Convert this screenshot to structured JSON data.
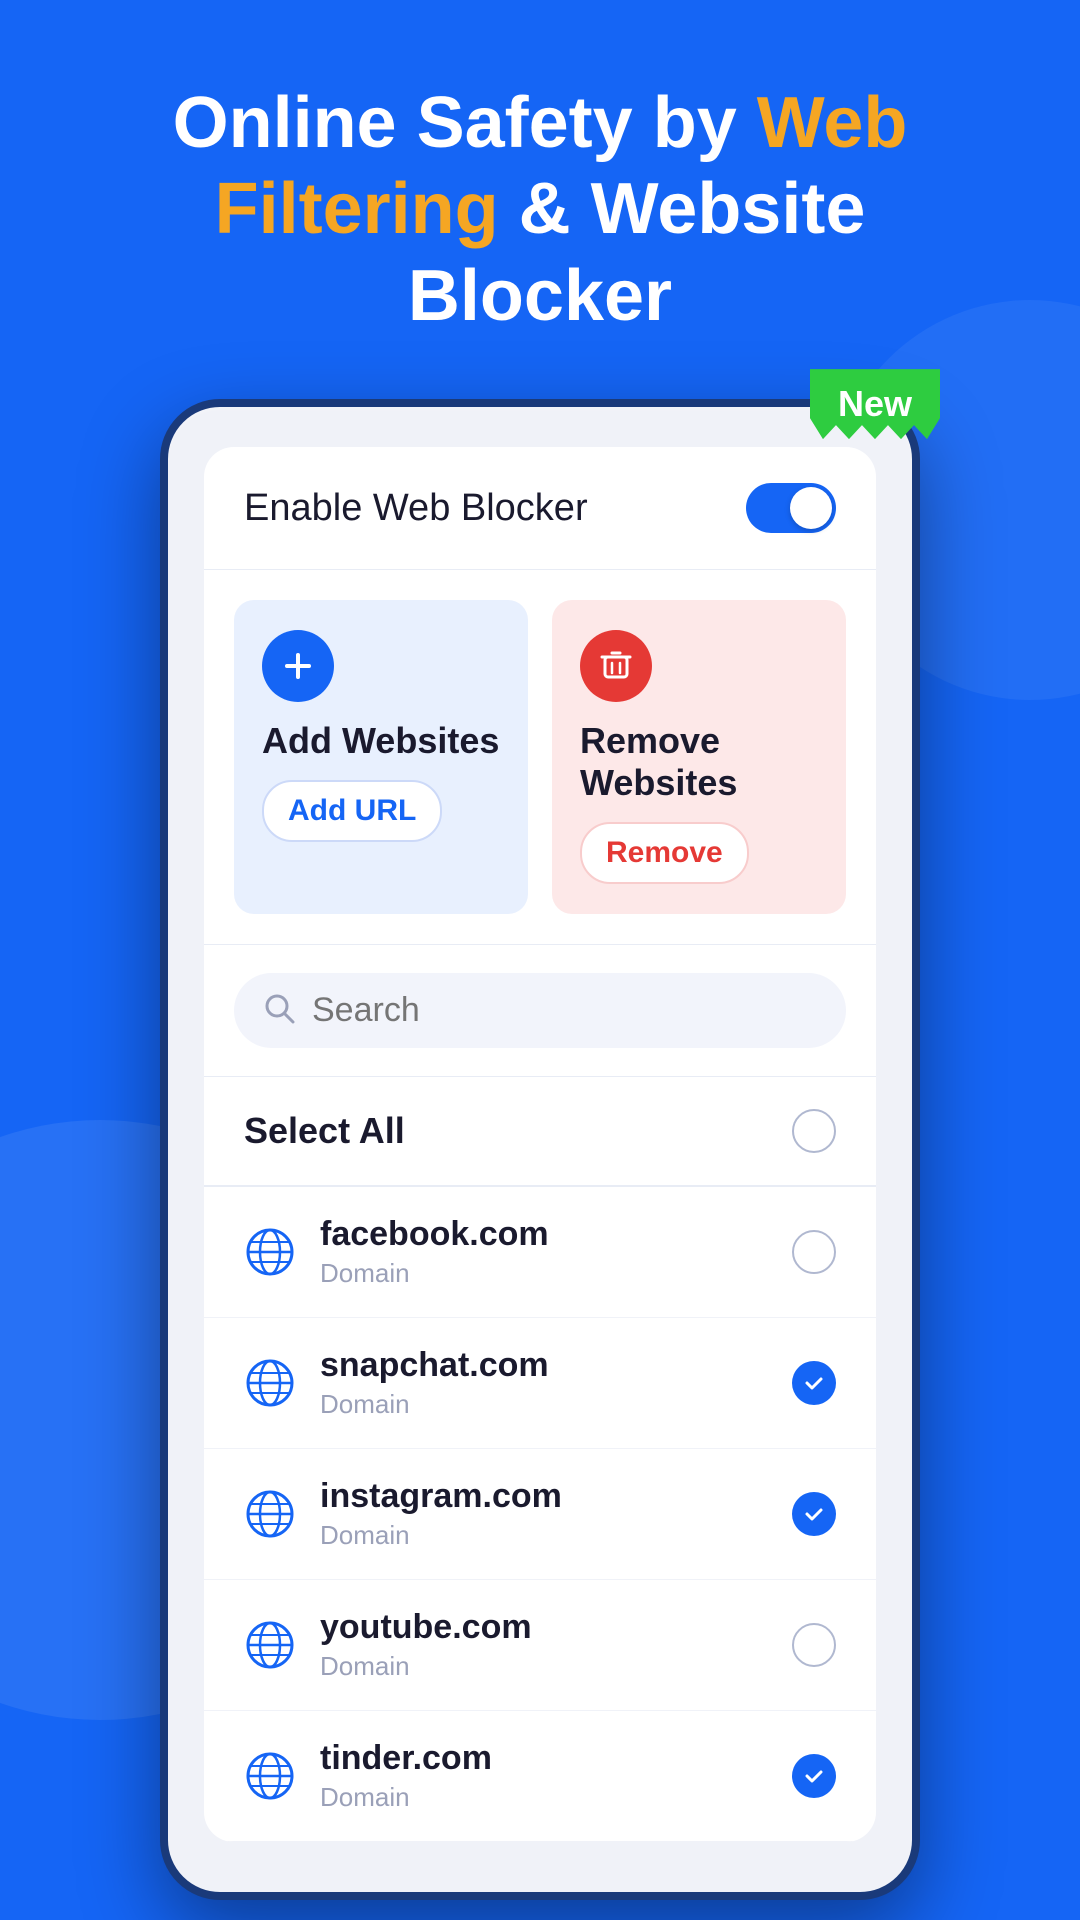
{
  "headline": {
    "line1": "Online Safety by ",
    "highlight1": "Web",
    "line2": "Filtering",
    "line2b": " & Website",
    "line3": "Blocker"
  },
  "new_badge": "New",
  "enable_blocker": {
    "label": "Enable Web Blocker",
    "enabled": true
  },
  "add_card": {
    "title": "Add Websites",
    "btn_label": "Add URL"
  },
  "remove_card": {
    "title": "Remove Websites",
    "btn_label": "Remove"
  },
  "search": {
    "placeholder": "Search"
  },
  "select_all": {
    "label": "Select All",
    "checked": false
  },
  "websites": [
    {
      "domain": "facebook.com",
      "type": "Domain",
      "checked": false
    },
    {
      "domain": "snapchat.com",
      "type": "Domain",
      "checked": true
    },
    {
      "domain": "instagram.com",
      "type": "Domain",
      "checked": true
    },
    {
      "domain": "youtube.com",
      "type": "Domain",
      "checked": false
    },
    {
      "domain": "tinder.com",
      "type": "Domain",
      "checked": true
    }
  ],
  "colors": {
    "primary": "#1565f5",
    "orange": "#f5a623",
    "green": "#2ecc40",
    "red": "#e53935",
    "bg_add": "#e8f0fe",
    "bg_remove": "#fde8e8"
  }
}
